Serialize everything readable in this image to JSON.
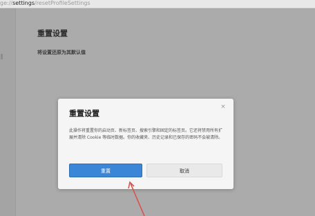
{
  "address_bar": {
    "prefix": "ge://",
    "host": "settings",
    "path": "/resetProfileSettings"
  },
  "settings_page": {
    "title": "重置设置",
    "item_label": "将设置还原为其默认值"
  },
  "dialog": {
    "title": "重置设置",
    "body": "此操作将重置你的启动页、新标签页、搜索引擎和固定的标签页。它还将禁用所有扩展并清除 Cookie 等临时数据。你的收藏夹、历史记录和已保存的密码不会被清除。",
    "close_symbol": "×",
    "reset_label": "重置",
    "cancel_label": "取消"
  },
  "colors": {
    "overlay": "#ababab",
    "primary_button": "#3b86d6",
    "annotation_arrow": "#d9534f"
  }
}
